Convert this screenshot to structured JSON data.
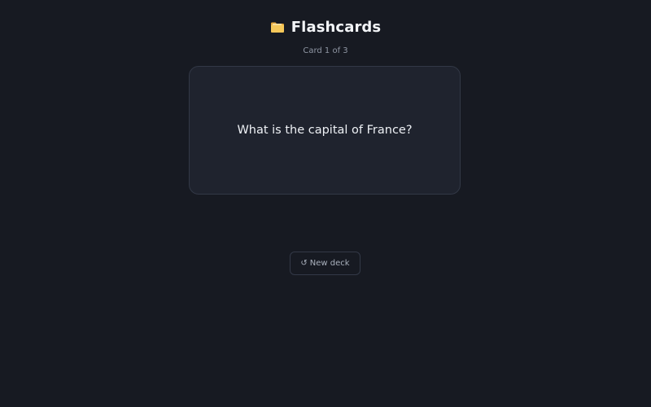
{
  "header": {
    "title": "Flashcards",
    "icon": "folder-icon"
  },
  "counter": {
    "text": "Card 1 of 3"
  },
  "card": {
    "question": "What is the capital of France?"
  },
  "actions": {
    "new_deck_icon": "↺",
    "new_deck_label": "New deck"
  },
  "colors": {
    "background": "#171a22",
    "card": "#1f232e",
    "folder": "#f2c14e"
  }
}
